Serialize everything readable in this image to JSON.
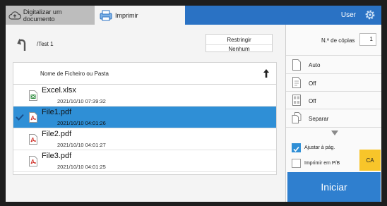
{
  "tabs": {
    "scan_label": "Digitalizar um documento",
    "print_label": "Imprimir"
  },
  "header": {
    "user_label": "User"
  },
  "path": {
    "current": "/Test 1"
  },
  "filter": {
    "label": "Restringir",
    "value": "Nenhum"
  },
  "file_list": {
    "header": "Nome de Ficheiro ou Pasta",
    "files": [
      {
        "name": "Excel.xlsx",
        "date": "2021/10/10 07:39:32",
        "type": "xlsx",
        "selected": false
      },
      {
        "name": "File1.pdf",
        "date": "2021/10/10 04:01:26",
        "type": "pdf",
        "selected": true
      },
      {
        "name": "File2.pdf",
        "date": "2021/10/10 04:01:27",
        "type": "pdf",
        "selected": false
      },
      {
        "name": "File3.pdf",
        "date": "2021/10/10 04:01:25",
        "type": "pdf",
        "selected": false
      }
    ]
  },
  "options": {
    "copies_label": "N.º de cópias",
    "copies_value": "1",
    "paper": "Auto",
    "duplex": "Off",
    "nup": "Off",
    "collate": "Separar",
    "fit_label": "Ajustar à pág.",
    "fit_checked": true,
    "bw_label": "Imprimir em P/B",
    "bw_checked": false,
    "ca_label": "CA",
    "start_label": "Iniciar"
  },
  "colors": {
    "accent": "#2a72c4",
    "selected_row": "#2f8fd6",
    "ca_button": "#f8c52a"
  }
}
